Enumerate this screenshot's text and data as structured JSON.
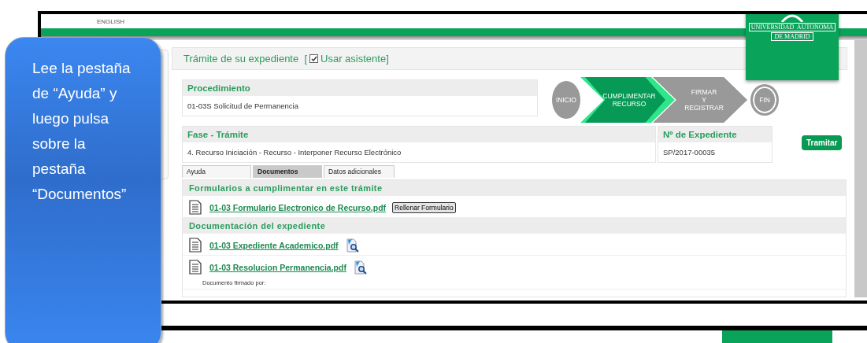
{
  "callout": {
    "text": "Lee la pestaña de “Ayuda” y luego pulsa sobre la pestaña “Documentos”"
  },
  "screen": {
    "language_link": "ENGLISH",
    "logo": {
      "line_1": "UNIVERSIDAD  AUTONOMA",
      "line_2": "DE MADRID"
    },
    "heading": "Trámite de su expediente  [",
    "assistant": {
      "label": "Usar asistente]",
      "checked": true
    },
    "procedure": {
      "label": "Procedimiento",
      "value": "01-03S Solicitud de Permanencia"
    },
    "steps": [
      {
        "kind": "start",
        "lines": [
          "INICIO"
        ],
        "selected": false
      },
      {
        "kind": "chevron",
        "lines": [
          "CUMPLIMENTAR",
          "RECURSO"
        ],
        "selected": true
      },
      {
        "kind": "chevron",
        "lines": [
          "FIRMAR",
          "Y",
          "REGISTRAR"
        ],
        "selected": false
      },
      {
        "kind": "end",
        "lines": [
          "FIN"
        ],
        "selected": false
      }
    ],
    "phase": {
      "label": "Fase - Trámite",
      "value": "4. Recurso Iniciación - Recurso - Interponer Recurso Electrónico"
    },
    "file_number": {
      "label": "Nº de Expediente",
      "value": "SP/2017-00035"
    },
    "process_button": "Tramitar",
    "tabs": [
      {
        "label": "Ayuda",
        "selected": false
      },
      {
        "label": "Documentos",
        "selected": true
      },
      {
        "label": "Datos adicionales",
        "selected": false
      }
    ],
    "sections": [
      {
        "title": "Formularios a cumplimentar en este trámite",
        "documents": [
          {
            "name": "01-03 Formulario Electronico de Recurso.pdf",
            "action": "Rellenar Formulario",
            "preview": false
          }
        ]
      },
      {
        "title": "Documentación del expediente",
        "documents": [
          {
            "name": "01-03 Expediente Academico.pdf",
            "preview": true
          },
          {
            "name": "01-03 Resolucion Permanencia.pdf",
            "preview": true,
            "note": "Documento firmado por:"
          }
        ]
      }
    ]
  }
}
